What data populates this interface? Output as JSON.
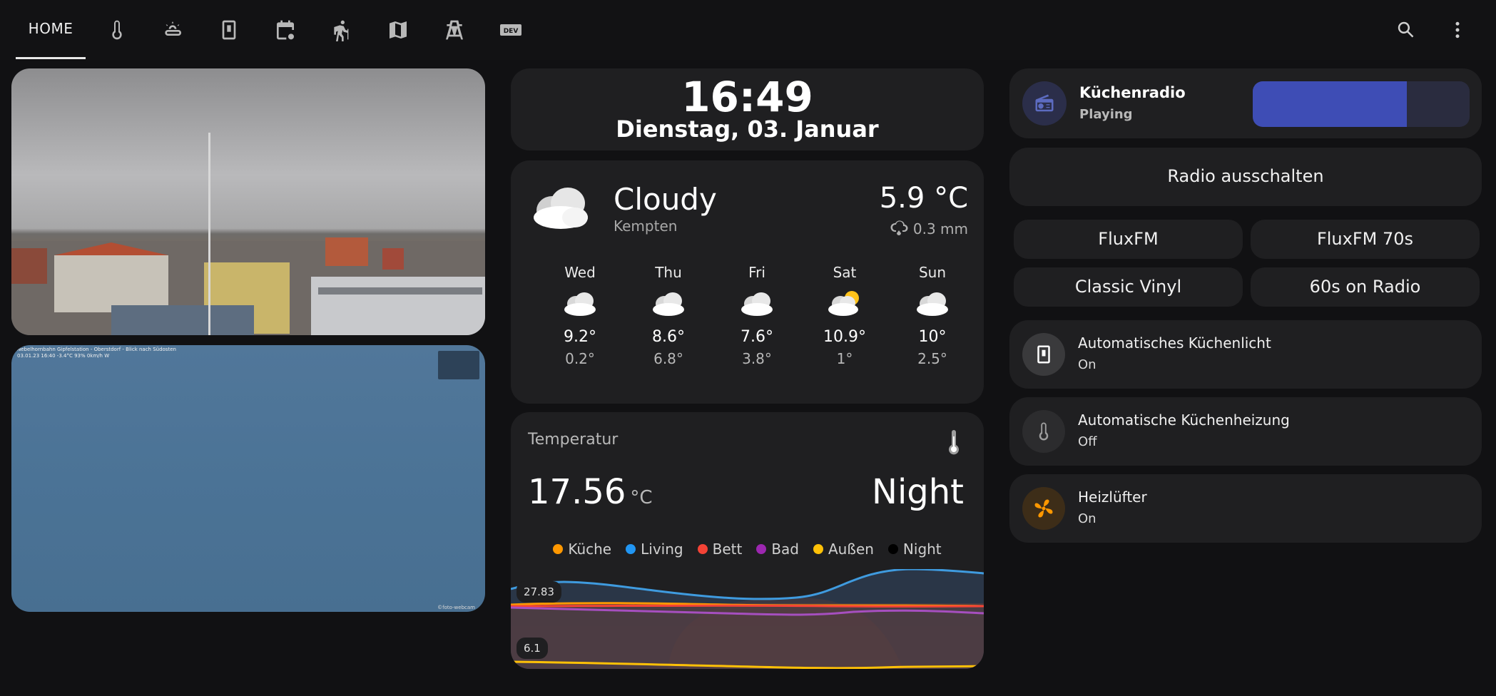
{
  "topbar": {
    "home_label": "HOME",
    "tabs": [
      {
        "icon": "thermometer-icon"
      },
      {
        "icon": "weather-partly-cloudy-icon"
      },
      {
        "icon": "light-switch-icon"
      },
      {
        "icon": "calendar-icon"
      },
      {
        "icon": "hiking-icon"
      },
      {
        "icon": "map-icon"
      },
      {
        "icon": "transmission-tower-icon"
      },
      {
        "icon": "dev-icon",
        "label": "DEV"
      }
    ],
    "search_icon": "search-icon",
    "menu_icon": "dots-vertical-icon"
  },
  "cameras": {
    "cam2_overlay_line1": "Nebelhornbahn Gipfelstation - Oberstdorf - Blick nach Südosten",
    "cam2_overlay_line2": "03.01.23 16:40   -3.4°C   93%   0km/h W",
    "cam2_corner": "©foto-webcam"
  },
  "clock": {
    "time": "16:49",
    "date": "Dienstag, 03. Januar"
  },
  "weather": {
    "condition": "Cloudy",
    "location": "Kempten",
    "temperature": "5.9 °C",
    "precipitation": "0.3 mm",
    "forecast": [
      {
        "day": "Wed",
        "icon": "cloudy",
        "high": "9.2°",
        "low": "0.2°"
      },
      {
        "day": "Thu",
        "icon": "cloudy",
        "high": "8.6°",
        "low": "6.8°"
      },
      {
        "day": "Fri",
        "icon": "cloudy",
        "high": "7.6°",
        "low": "3.8°"
      },
      {
        "day": "Sat",
        "icon": "partly-cloudy",
        "high": "10.9°",
        "low": "1°"
      },
      {
        "day": "Sun",
        "icon": "cloudy",
        "high": "10°",
        "low": "2.5°"
      }
    ]
  },
  "temperature_card": {
    "title": "Temperatur",
    "value": "17.56",
    "unit": "°C",
    "state": "Night",
    "legend": [
      {
        "name": "Küche",
        "color": "#ff9800"
      },
      {
        "name": "Living",
        "color": "#2196f3"
      },
      {
        "name": "Bett",
        "color": "#f44336"
      },
      {
        "name": "Bad",
        "color": "#9c27b0"
      },
      {
        "name": "Außen",
        "color": "#ffc107"
      },
      {
        "name": "Night",
        "color": "#000000"
      }
    ],
    "graph_max": "27.83",
    "graph_min": "6.1"
  },
  "radio": {
    "name": "Küchenradio",
    "state": "Playing",
    "volume_fraction": 0.71,
    "off_button": "Radio ausschalten",
    "stations": [
      "FluxFM",
      "FluxFM 70s",
      "Classic Vinyl",
      "60s on Radio"
    ]
  },
  "entities": [
    {
      "name": "Automatisches Küchenlicht",
      "state": "On",
      "icon": "light-switch-icon",
      "icon_color": "#ffffff",
      "bg": "#3a3a3c"
    },
    {
      "name": "Automatische Küchenheizung",
      "state": "Off",
      "icon": "thermometer-icon",
      "icon_color": "#9e9e9e",
      "bg": "#2c2c2e"
    },
    {
      "name": "Heizlüfter",
      "state": "On",
      "icon": "fan-icon",
      "icon_color": "#ff9800",
      "bg": "#3d2d18"
    }
  ],
  "colors": {
    "accent": "#3e4db5",
    "card_bg": "#1f1f21",
    "background": "#111113"
  }
}
